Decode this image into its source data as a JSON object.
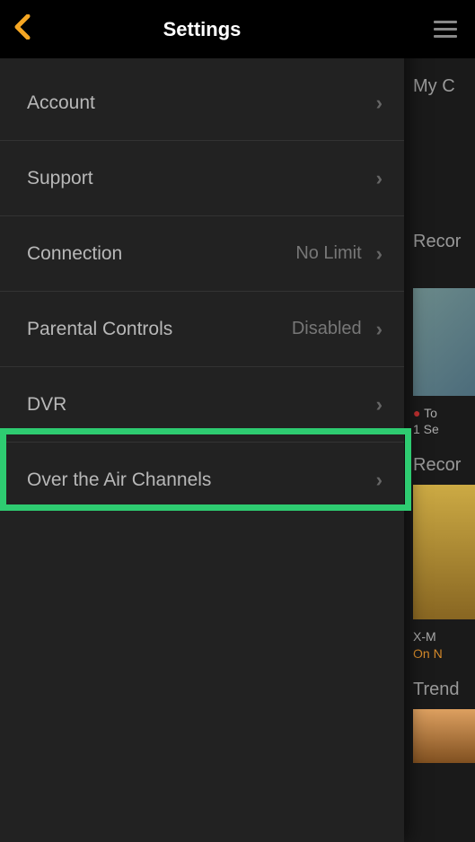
{
  "header": {
    "title": "Settings"
  },
  "menu": {
    "account": {
      "label": "Account",
      "value": ""
    },
    "support": {
      "label": "Support",
      "value": ""
    },
    "connection": {
      "label": "Connection",
      "value": "No Limit"
    },
    "parental": {
      "label": "Parental Controls",
      "value": "Disabled"
    },
    "dvr": {
      "label": "DVR",
      "value": ""
    },
    "ota": {
      "label": "Over the Air Channels",
      "value": ""
    }
  },
  "background": {
    "section1": "My C",
    "section2": "Recor",
    "live1": "To",
    "live2": "1 Se",
    "section3": "Recor",
    "movie_title": "X-M",
    "movie_sub": "On N",
    "section4": "Trend"
  }
}
